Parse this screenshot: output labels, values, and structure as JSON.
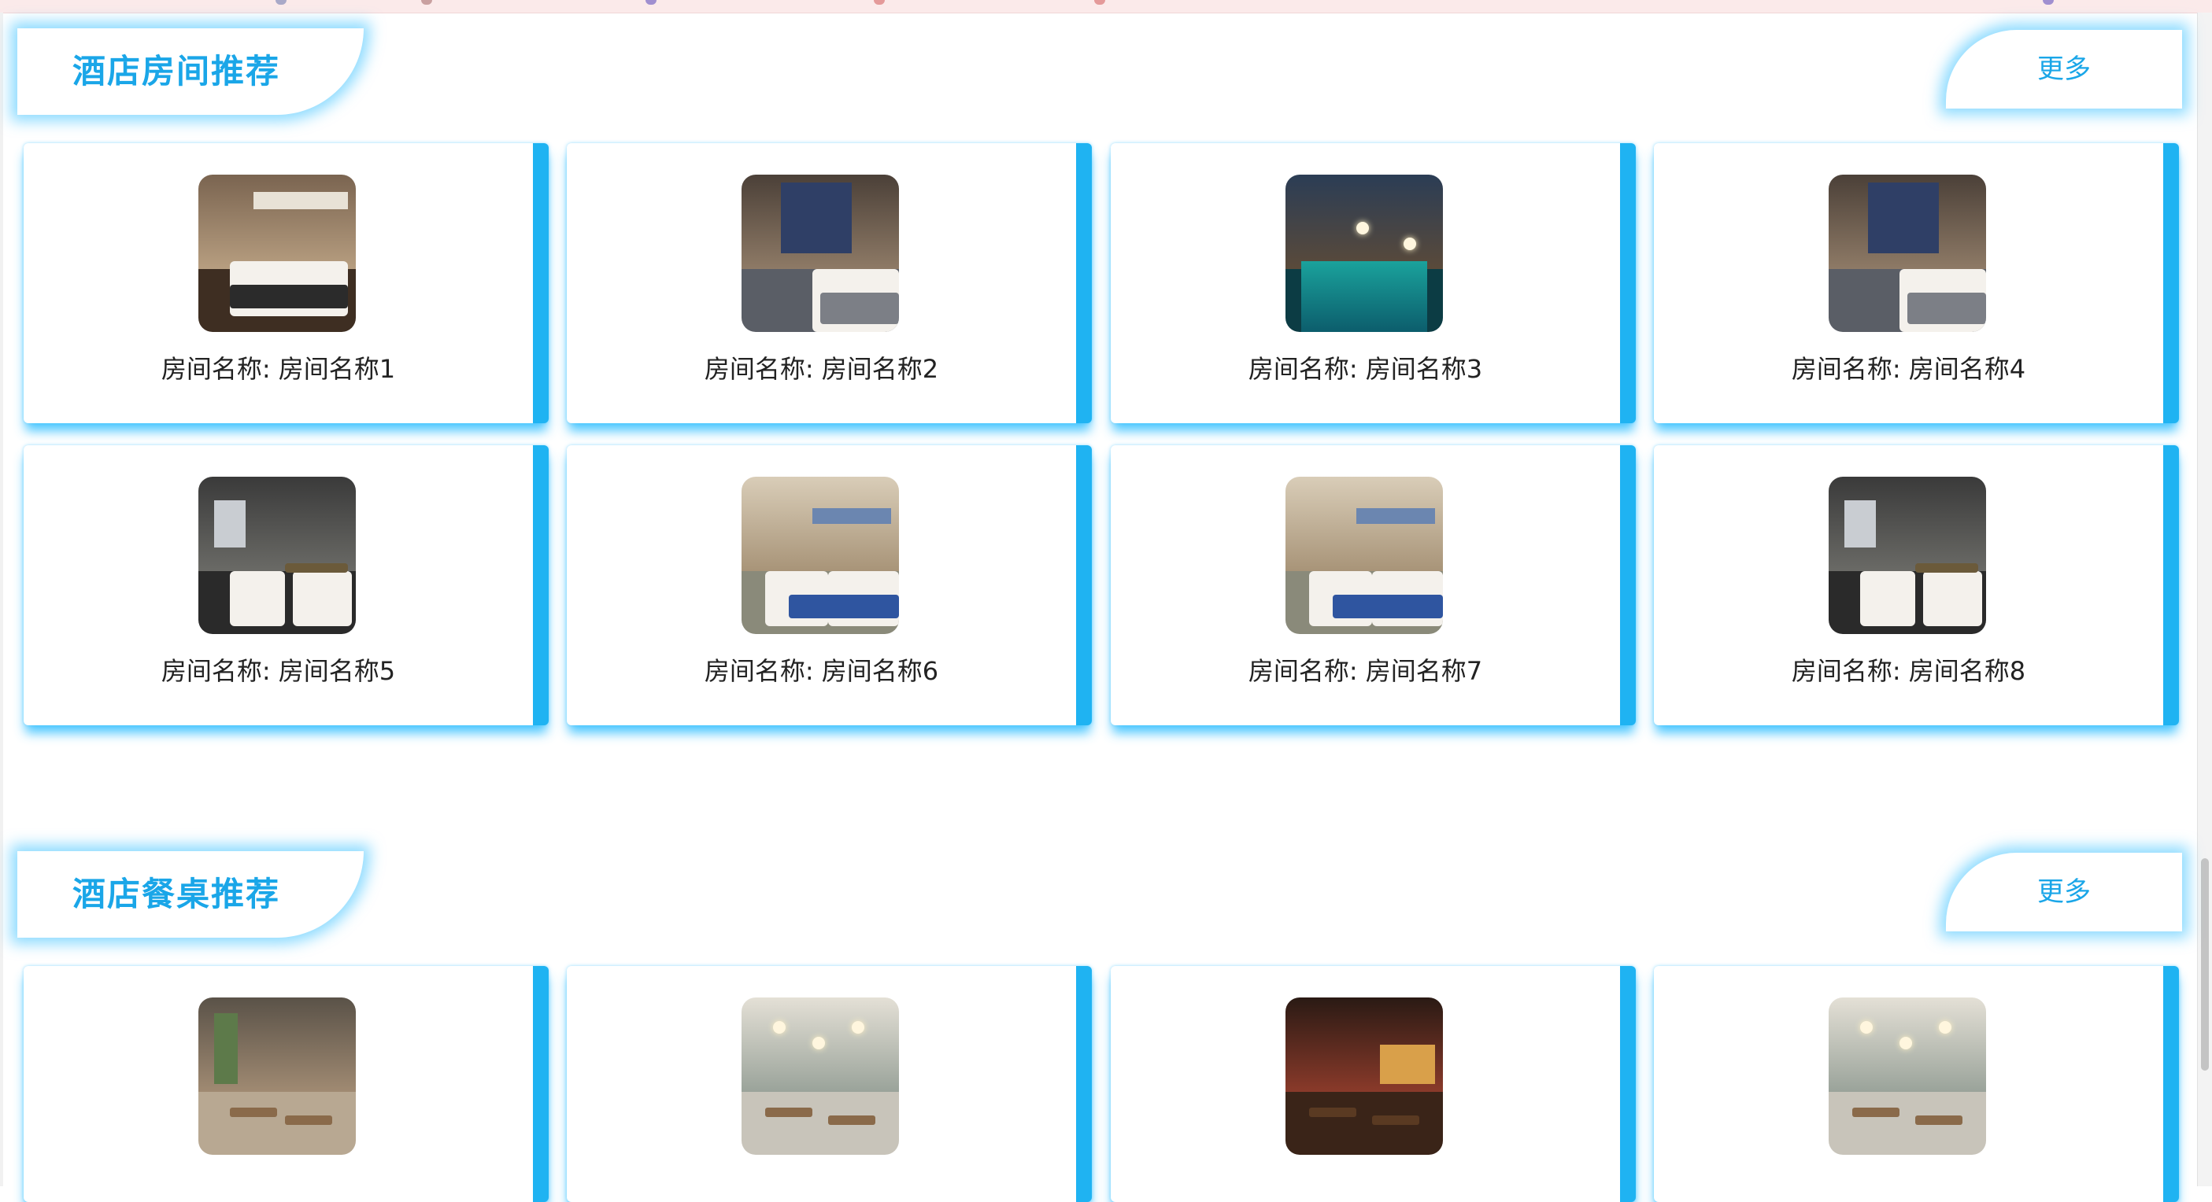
{
  "sections": [
    {
      "title": "酒店房间推荐",
      "more_label": "更多",
      "cards": [
        {
          "label_prefix": "房间名称: ",
          "name": "房间名称1",
          "image": "hotel-room-double-bed"
        },
        {
          "label_prefix": "房间名称: ",
          "name": "房间名称2",
          "image": "hotel-room-city-window"
        },
        {
          "label_prefix": "房间名称: ",
          "name": "房间名称3",
          "image": "hotel-pool-night"
        },
        {
          "label_prefix": "房间名称: ",
          "name": "房间名称4",
          "image": "hotel-room-city-window"
        },
        {
          "label_prefix": "房间名称: ",
          "name": "房间名称5",
          "image": "hotel-room-twin-beds-dark"
        },
        {
          "label_prefix": "房间名称: ",
          "name": "房间名称6",
          "image": "hotel-room-twin-beds-blue"
        },
        {
          "label_prefix": "房间名称: ",
          "name": "房间名称7",
          "image": "hotel-room-twin-beds-blue"
        },
        {
          "label_prefix": "房间名称: ",
          "name": "房间名称8",
          "image": "hotel-room-twin-beds-dark"
        }
      ]
    },
    {
      "title": "酒店餐桌推荐",
      "more_label": "更多",
      "cards": [
        {
          "image": "restaurant-interior-plants"
        },
        {
          "image": "restaurant-interior-pendant-lamps"
        },
        {
          "image": "restaurant-interior-bar"
        },
        {
          "image": "restaurant-interior-pendant-lamps"
        }
      ]
    }
  ],
  "colors": {
    "accent": "#1fb3f2",
    "title_text": "#1aa6e8",
    "glow": "#30beff"
  }
}
